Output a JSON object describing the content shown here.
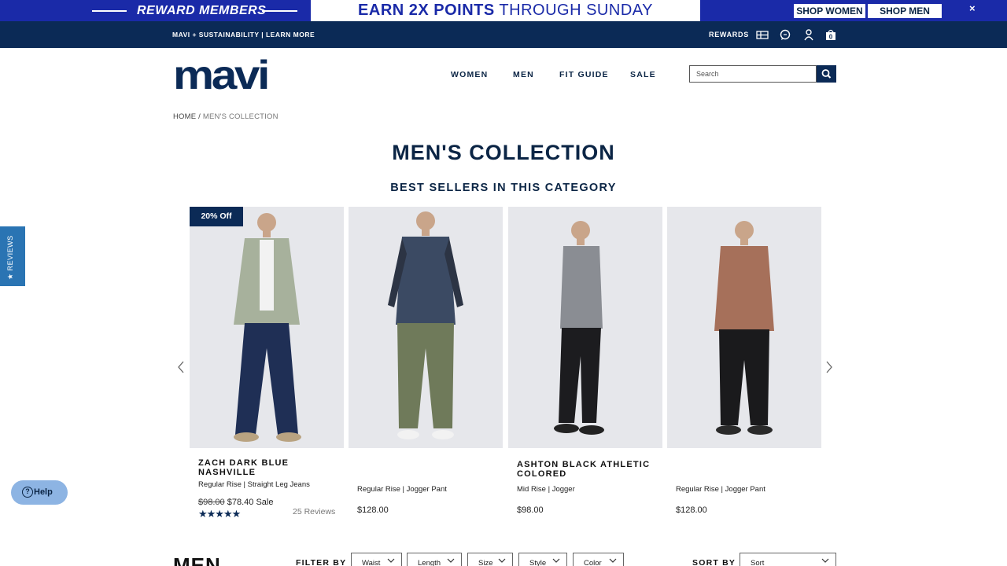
{
  "promo": {
    "rewards_label": "REWARD MEMBERS",
    "earn_bold": "EARN 2X POINTS",
    "earn_rest": " THROUGH SUNDAY",
    "shop_women": "SHOP WOMEN",
    "shop_men": "SHOP MEN",
    "close": "×"
  },
  "utility": {
    "left_links": "MAVI + SUSTAINABILITY | LEARN MORE",
    "rewards": "REWARDS",
    "cart_count": "0"
  },
  "header": {
    "logo": "mavi",
    "nav": [
      "WOMEN",
      "MEN",
      "FIT GUIDE",
      "SALE"
    ],
    "search_placeholder": "Search"
  },
  "breadcrumb": {
    "home": "HOME",
    "sep": " / ",
    "current": "MEN'S COLLECTION"
  },
  "page_title": "MEN'S COLLECTION",
  "best_sellers_title": "BEST SELLERS IN THIS CATEGORY",
  "reviews_tab": "★ REVIEWS",
  "products": [
    {
      "badge": "20% Off",
      "name": "ZACH DARK BLUE NASHVILLE",
      "desc": "Regular Rise | Straight Leg Jeans",
      "old_price": "$98.00",
      "sale_price": "$78.40",
      "sale_label": "Sale",
      "stars": "★★★★★",
      "reviews": "25 Reviews",
      "shirt_color": "#a7b19c",
      "pants_color": "#1f2f55"
    },
    {
      "badge": "",
      "name": "",
      "desc": "Regular Rise | Jogger Pant",
      "price": "$128.00",
      "shirt_color": "#3b4a63",
      "pants_color": "#6f7a5a"
    },
    {
      "badge": "",
      "name": "ASHTON BLACK ATHLETIC COLORED",
      "desc": "Mid Rise | Jogger",
      "price": "$98.00",
      "shirt_color": "#8a8d93",
      "pants_color": "#1c1c1f"
    },
    {
      "badge": "",
      "name": "",
      "desc": "Regular Rise | Jogger Pant",
      "price": "$128.00",
      "shirt_color": "#a6705a",
      "pants_color": "#1a1a1c"
    }
  ],
  "help_label": "Help",
  "filter_bar": {
    "heading": "MEN",
    "filter_by": "FILTER BY",
    "filters": [
      "Waist",
      "Length",
      "Size",
      "Style",
      "Color"
    ],
    "sort_by": "SORT BY",
    "sort_value": "Sort"
  },
  "colors": {
    "navy": "#0b2a56",
    "promo_blue": "#1a2aa8",
    "help_blue": "#8db4e3",
    "reviews_tab_blue": "#2a74b3"
  }
}
